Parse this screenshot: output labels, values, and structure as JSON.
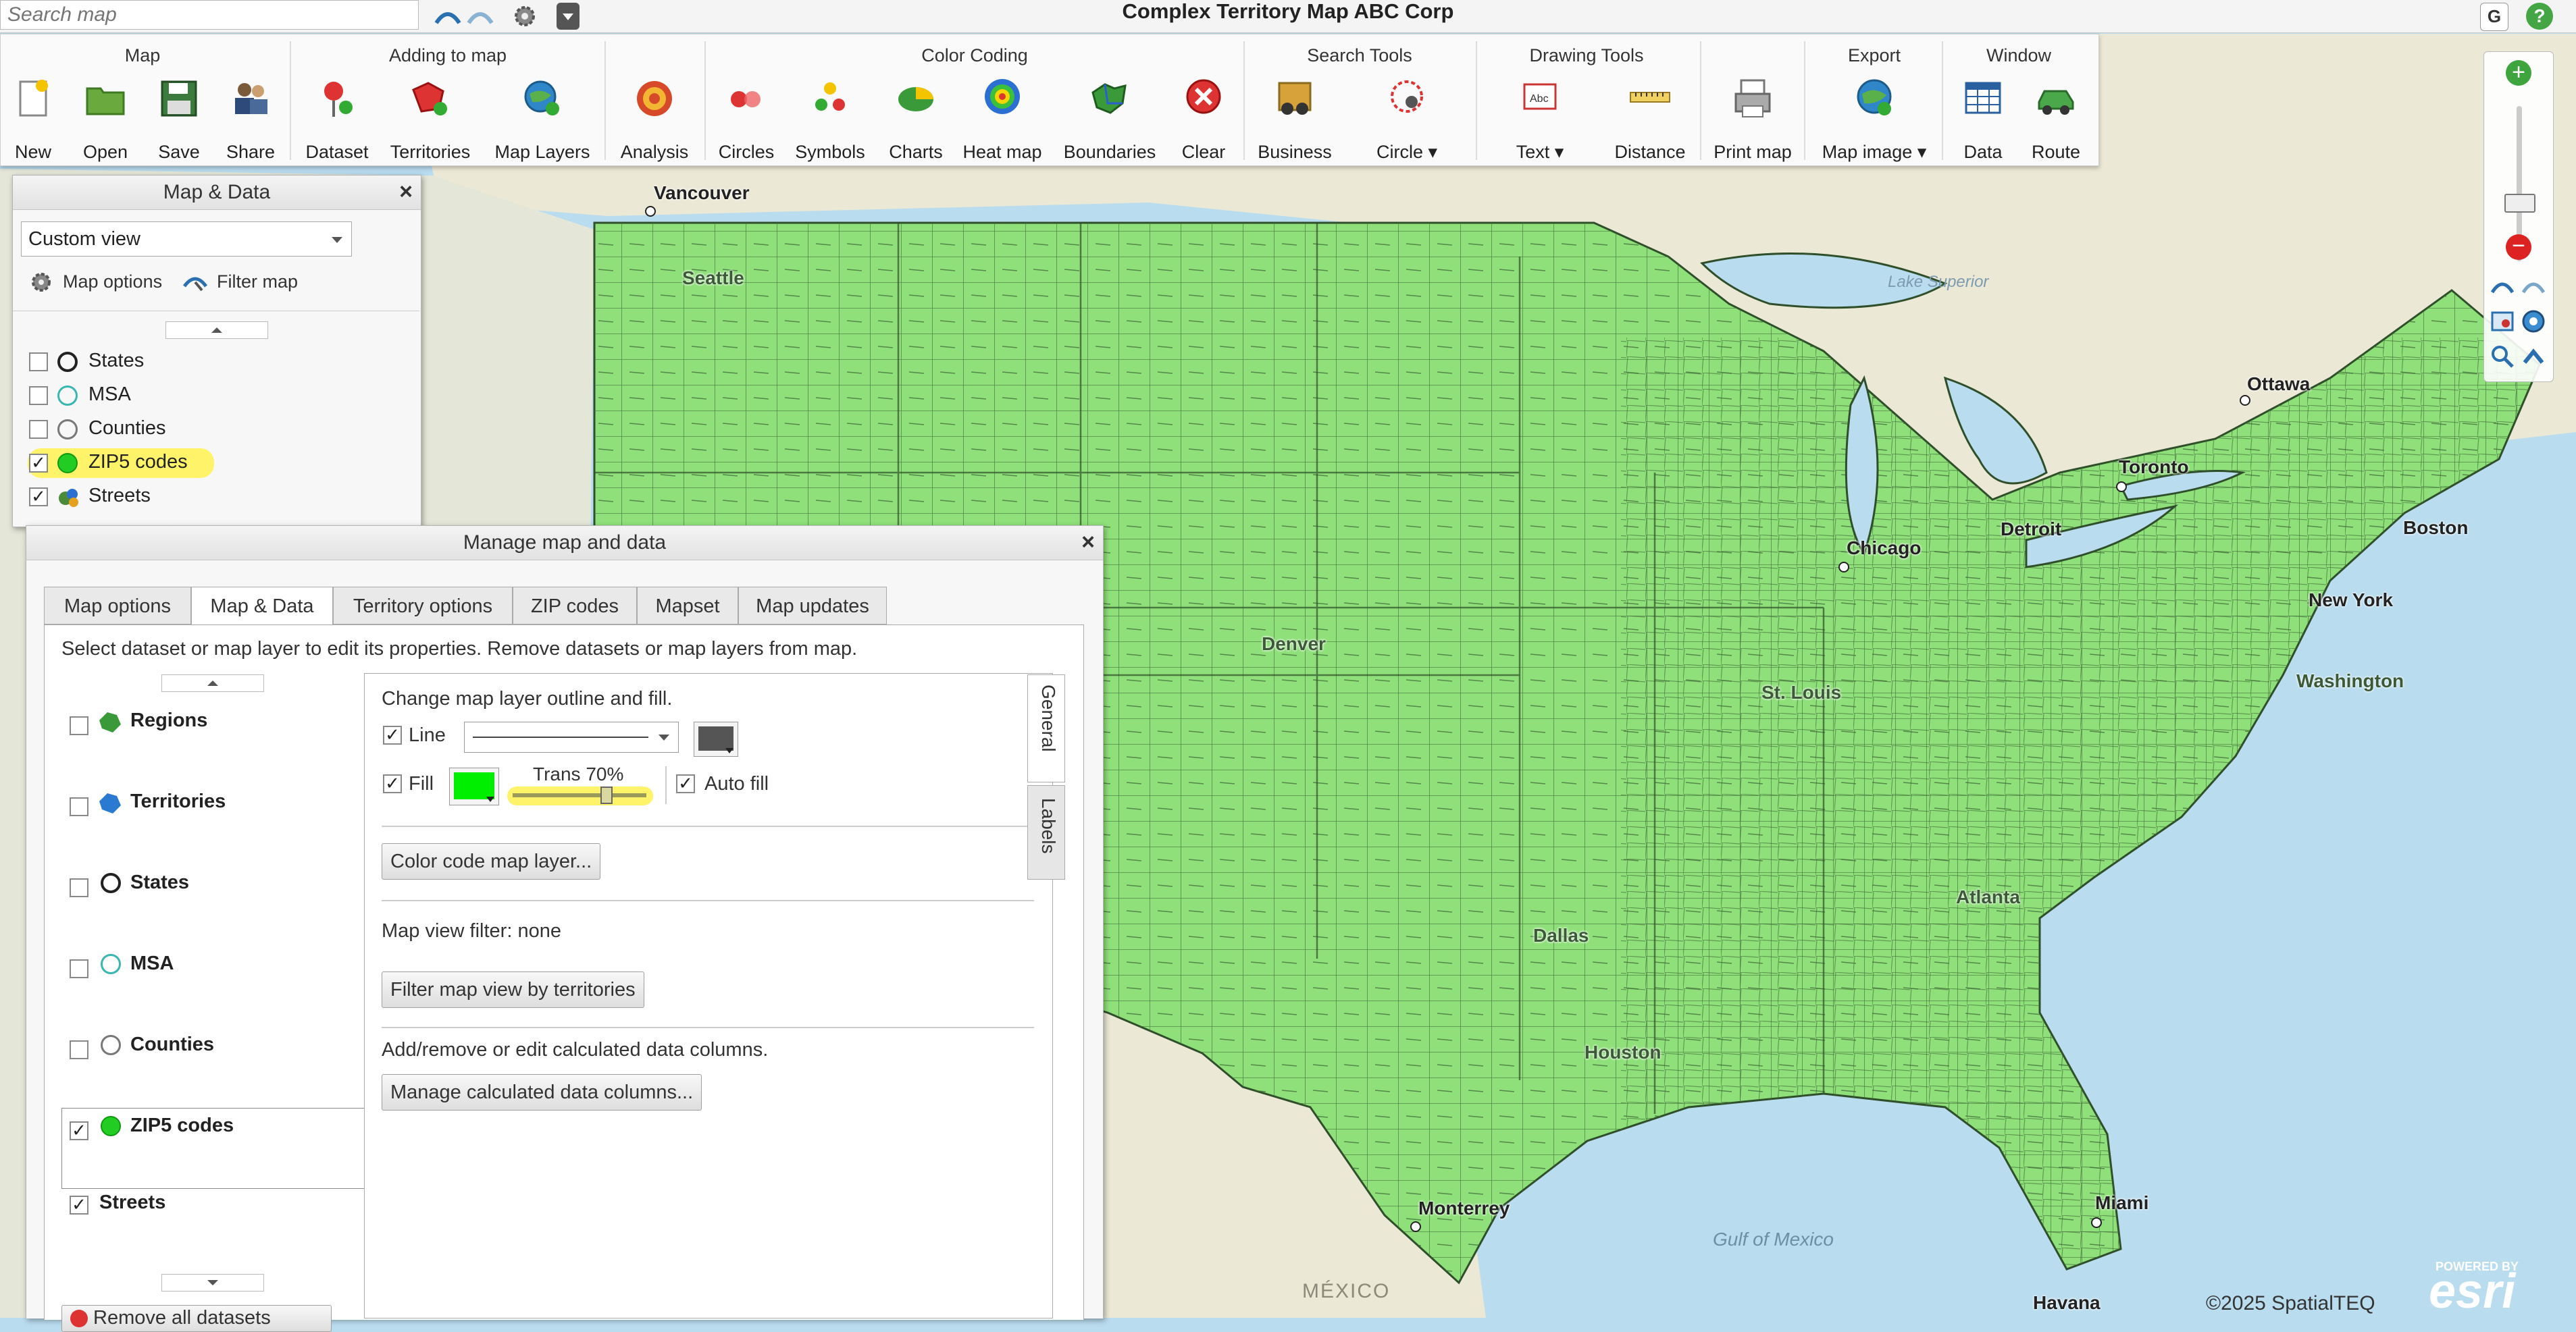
{
  "search": {
    "placeholder": "Search map"
  },
  "app_title": "Complex Territory Map ABC Corp",
  "topbar": {
    "g_badge": "G",
    "help_badge": "?"
  },
  "ribbon": {
    "groups": [
      {
        "title": "Map",
        "buttons": [
          {
            "label": "New",
            "icon": "new-file-icon"
          },
          {
            "label": "Open",
            "icon": "folder-icon"
          },
          {
            "label": "Save",
            "icon": "floppy-disk-icon"
          },
          {
            "label": "Share",
            "icon": "users-icon"
          }
        ]
      },
      {
        "title": "Adding to map",
        "buttons": [
          {
            "label": "Dataset",
            "icon": "pin-add-icon"
          },
          {
            "label": "Territories",
            "icon": "territory-add-icon"
          },
          {
            "label": "Map Layers",
            "icon": "globe-add-icon"
          }
        ]
      },
      {
        "title": "",
        "buttons": [
          {
            "label": "Analysis",
            "icon": "target-icon"
          }
        ]
      },
      {
        "title": "Color Coding",
        "buttons": [
          {
            "label": "Circles",
            "icon": "circles-icon"
          },
          {
            "label": "Symbols",
            "icon": "symbols-icon"
          },
          {
            "label": "Charts",
            "icon": "pie-chart-icon"
          },
          {
            "label": "Heat map",
            "icon": "heat-map-icon"
          },
          {
            "label": "Boundaries",
            "icon": "boundaries-icon"
          },
          {
            "label": "Clear",
            "icon": "clear-icon"
          }
        ]
      },
      {
        "title": "Search Tools",
        "buttons": [
          {
            "label": "Business",
            "icon": "binoculars-icon"
          },
          {
            "label": "Circle ▾",
            "icon": "circle-search-icon"
          }
        ]
      },
      {
        "title": "Drawing Tools",
        "buttons": [
          {
            "label": "Text ▾",
            "icon": "text-box-icon"
          },
          {
            "label": "Distance",
            "icon": "ruler-icon"
          }
        ]
      },
      {
        "title": "",
        "buttons": [
          {
            "label": "Print map",
            "icon": "printer-icon"
          }
        ]
      },
      {
        "title": "Export",
        "buttons": [
          {
            "label": "Map image ▾",
            "icon": "globe-export-icon"
          }
        ]
      },
      {
        "title": "Window",
        "buttons": [
          {
            "label": "Data",
            "icon": "table-icon"
          },
          {
            "label": "Route",
            "icon": "car-icon"
          }
        ]
      }
    ]
  },
  "map_data_panel": {
    "title": "Map & Data",
    "close": "×",
    "view_select": "Custom view",
    "map_options": "Map options",
    "filter_map": "Filter map",
    "layers": [
      {
        "label": "States",
        "checked": false,
        "color": "#222222"
      },
      {
        "label": "MSA",
        "checked": false,
        "color": "#3ab6b0"
      },
      {
        "label": "Counties",
        "checked": false,
        "color": "#777777"
      },
      {
        "label": "ZIP5 codes",
        "checked": true,
        "color": "#22cc22"
      },
      {
        "label": "Streets",
        "checked": true,
        "color": "#4a8a3a"
      }
    ]
  },
  "manage_dialog": {
    "title": "Manage map and data",
    "close": "×",
    "tabs": [
      "Map options",
      "Map & Data",
      "Territory options",
      "ZIP codes",
      "Mapset",
      "Map updates"
    ],
    "active_tab": "Map & Data",
    "instruction": "Select dataset or map layer to edit its properties. Remove datasets or map layers from map.",
    "layers": [
      {
        "label": "Regions",
        "checked": false
      },
      {
        "label": "Territories",
        "checked": false
      },
      {
        "label": "States",
        "checked": false
      },
      {
        "label": "MSA",
        "checked": false
      },
      {
        "label": "Counties",
        "checked": false
      },
      {
        "label": "ZIP5 codes",
        "checked": true
      },
      {
        "label": "Streets",
        "checked": true
      }
    ],
    "remove_all": "Remove all datasets",
    "props": {
      "heading": "Change map layer outline and fill.",
      "line_label": "Line",
      "fill_label": "Fill",
      "trans_label": "Trans 70%",
      "transparency": 0.7,
      "auto_fill_label": "Auto fill",
      "line_color": "#555555",
      "fill_color": "#00ee00",
      "color_code_btn": "Color code map layer...",
      "filter_text": "Map view filter: none",
      "filter_btn": "Filter map view by territories",
      "calc_text": "Add/remove or edit calculated data columns.",
      "calc_btn": "Manage calculated data columns..."
    },
    "side_tabs": [
      "General",
      "Labels"
    ]
  },
  "map": {
    "cities": [
      "Vancouver",
      "Seattle",
      "Denver",
      "Dallas",
      "Houston",
      "Chicago",
      "Detroit",
      "Toronto",
      "Ottawa",
      "Boston",
      "New York",
      "Washington",
      "St. Louis",
      "Atlanta",
      "Miami",
      "Havana",
      "Monterrey"
    ],
    "water_labels": [
      "Lake Superior",
      "Gulf of Mexico"
    ],
    "country_label": "MÉXICO",
    "copyright": "©2025 SpatialTEQ",
    "esri_powered": "POWERED BY",
    "esri": "esri",
    "land_color": "#8fe07a",
    "water_color": "#b9dcef"
  }
}
